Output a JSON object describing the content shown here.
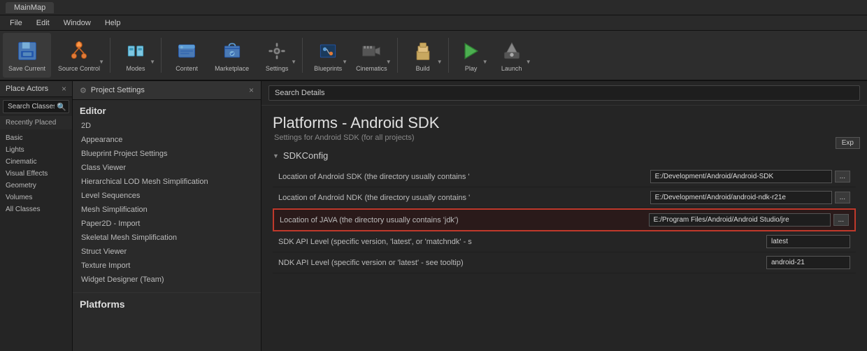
{
  "titleBar": {
    "tab": "MainMap"
  },
  "menuBar": {
    "items": [
      "File",
      "Edit",
      "Window",
      "Help"
    ]
  },
  "toolbar": {
    "buttons": [
      {
        "id": "save-current",
        "label": "Save Current",
        "icon": "💾",
        "hasArrow": false
      },
      {
        "id": "source-control",
        "label": "Source Control",
        "icon": "⬆",
        "hasArrow": true
      },
      {
        "id": "modes",
        "label": "Modes",
        "icon": "🔧",
        "hasArrow": true
      },
      {
        "id": "content",
        "label": "Content",
        "icon": "📁",
        "hasArrow": false
      },
      {
        "id": "marketplace",
        "label": "Marketplace",
        "icon": "🛒",
        "hasArrow": false
      },
      {
        "id": "settings",
        "label": "Settings",
        "icon": "⚙",
        "hasArrow": true
      },
      {
        "id": "blueprints",
        "label": "Blueprints",
        "icon": "📋",
        "hasArrow": true
      },
      {
        "id": "cinematics",
        "label": "Cinematics",
        "icon": "🎬",
        "hasArrow": true
      },
      {
        "id": "build",
        "label": "Build",
        "icon": "🏗",
        "hasArrow": true
      },
      {
        "id": "play",
        "label": "Play",
        "icon": "▶",
        "hasArrow": true
      },
      {
        "id": "launch",
        "label": "Launch",
        "icon": "🚀",
        "hasArrow": true
      }
    ]
  },
  "leftPanel": {
    "title": "Place Actors",
    "closeLabel": "×",
    "searchPlaceholder": "Search Classes",
    "recentlyPlaced": "Recently Placed",
    "categories": [
      {
        "label": "Basic"
      },
      {
        "label": "Lights"
      },
      {
        "label": "Cinematic"
      },
      {
        "label": "Visual Effects"
      },
      {
        "label": "Geometry"
      },
      {
        "label": "Volumes"
      },
      {
        "label": "All Classes"
      }
    ]
  },
  "settingsSidebar": {
    "title": "Project Settings",
    "closeLabel": "×",
    "sectionTitle": "Editor",
    "navItems": [
      {
        "label": "2D",
        "active": false
      },
      {
        "label": "Appearance",
        "active": false
      },
      {
        "label": "Blueprint Project Settings",
        "active": false
      },
      {
        "label": "Class Viewer",
        "active": false
      },
      {
        "label": "Hierarchical LOD Mesh Simplification",
        "active": false
      },
      {
        "label": "Level Sequences",
        "active": false
      },
      {
        "label": "Mesh Simplification",
        "active": false
      },
      {
        "label": "Paper2D - Import",
        "active": false
      },
      {
        "label": "Skeletal Mesh Simplification",
        "active": false
      },
      {
        "label": "Struct Viewer",
        "active": false
      },
      {
        "label": "Texture Import",
        "active": false
      },
      {
        "label": "Widget Designer (Team)",
        "active": false
      }
    ],
    "bottomSection": "Platforms"
  },
  "contentArea": {
    "searchPlaceholder": "Search Details",
    "pageTitle": "Platforms - Android SDK",
    "pageSubtitle": "Settings for Android SDK (for all projects)",
    "expandLabel": "Exp",
    "sdkSection": {
      "title": "SDKConfig",
      "rows": [
        {
          "id": "android-sdk",
          "label": "Location of Android SDK (the directory usually contains '",
          "value": "E:/Development/Android/Android-SDK",
          "hasBrowse": true,
          "highlighted": false
        },
        {
          "id": "android-ndk",
          "label": "Location of Android NDK (the directory usually contains '",
          "value": "E:/Development/Android/android-ndk-r21e",
          "hasBrowse": true,
          "highlighted": false
        },
        {
          "id": "java-location",
          "label": "Location of JAVA (the directory usually contains 'jdk')",
          "value": "E:/Program Files/Android/Android Studio/jre",
          "hasBrowse": true,
          "highlighted": true
        },
        {
          "id": "sdk-api-level",
          "label": "SDK API Level (specific version, 'latest', or 'matchndk' - s",
          "value": "latest",
          "hasBrowse": false,
          "highlighted": false
        },
        {
          "id": "ndk-api-level",
          "label": "NDK API Level (specific version or 'latest' - see tooltip)",
          "value": "android-21",
          "hasBrowse": false,
          "highlighted": false
        }
      ]
    }
  }
}
